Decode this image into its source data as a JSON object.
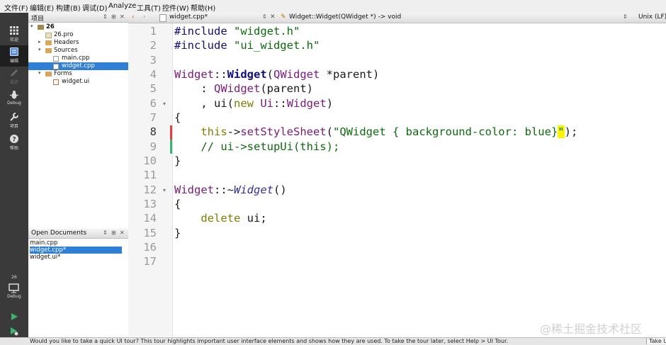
{
  "menubar": {
    "items": [
      "文件(F)",
      "编辑(E)",
      "构建(B)",
      "调试(D)",
      "Analyze",
      "工具(T)",
      "控件(W)",
      "帮助(H)"
    ]
  },
  "modebar": {
    "modes": [
      {
        "label": "欢迎",
        "icon": "grid-icon"
      },
      {
        "label": "编辑",
        "icon": "document-icon"
      },
      {
        "label": "设计",
        "icon": "pen-icon"
      },
      {
        "label": "Debug",
        "icon": "bug-icon"
      },
      {
        "label": "项目",
        "icon": "wrench-icon"
      },
      {
        "label": "帮助",
        "icon": "help-icon"
      }
    ],
    "kit_name": "26",
    "kit_config": "Debug"
  },
  "sidebar": {
    "projects_title": "项目",
    "tree": {
      "root": "26",
      "pro_file": "26.pro",
      "headers": "Headers",
      "sources": "Sources",
      "main_cpp": "main.cpp",
      "widget_cpp": "widget.cpp",
      "forms": "Forms",
      "widget_ui": "widget.ui"
    },
    "open_documents_title": "Open Documents",
    "open_documents": [
      "main.cpp",
      "widget.cpp*",
      "widget.ui*"
    ]
  },
  "editor": {
    "file_tab": "widget.cpp*",
    "symbol": "Widget::Widget(QWidget *) -> void",
    "line_ending": "Unix (LF)",
    "line_numbers": [
      "1",
      "2",
      "3",
      "4",
      "5",
      "6",
      "7",
      "8",
      "9",
      "10",
      "11",
      "12",
      "13",
      "14",
      "15",
      "16",
      "17"
    ],
    "current_line": "8",
    "code": {
      "l1_directive": "#include",
      "l1_file": " \"widget.h\"",
      "l2_directive": "#include",
      "l2_file": " \"ui_widget.h\"",
      "l4_class": "Widget",
      "l4_sep": "::",
      "l4_ctor": "Widget",
      "l4_open": "(",
      "l4_type": "QWidget",
      "l4_rest": " *parent)",
      "l5_lead": "    : ",
      "l5_type": "QWidget",
      "l5_rest": "(parent)",
      "l6_lead": "    , ui(",
      "l6_new": "new",
      "l6_space": " ",
      "l6_ns": "Ui",
      "l6_sep": "::",
      "l6_type": "Widget",
      "l6_close": ")",
      "l7": "{",
      "l8_lead": "    ",
      "l8_this": "this",
      "l8_arrow": "->",
      "l8_method": "setStyleSheet",
      "l8_open": "(",
      "l8_string": "\"QWidget { background-color: blue}",
      "l8_quote": "\"",
      "l8_close": ");",
      "l9": "    // ui->setupUi(this);",
      "l10": "}",
      "l12_class": "Widget",
      "l12_sep": "::~",
      "l12_dtor": "Widget",
      "l12_rest": "()",
      "l13": "{",
      "l14_lead": "    ",
      "l14_kw": "delete",
      "l14_rest": " ui;",
      "l15": "}"
    }
  },
  "statusbar": {
    "message": "Would you like to take a quick UI tour? This tour highlights important user interface elements and shows how they are used. To take the tour later, select Help > UI Tour.",
    "take_button": "Take UI Tour"
  },
  "watermark": "@稀土掘金技术社区",
  "colors": {
    "selection": "#2f7fd6",
    "modebar": "#3a3a3a",
    "current_line_change": "#e04040",
    "saved_change": "#3cb371",
    "highlight": "#f8f500"
  }
}
